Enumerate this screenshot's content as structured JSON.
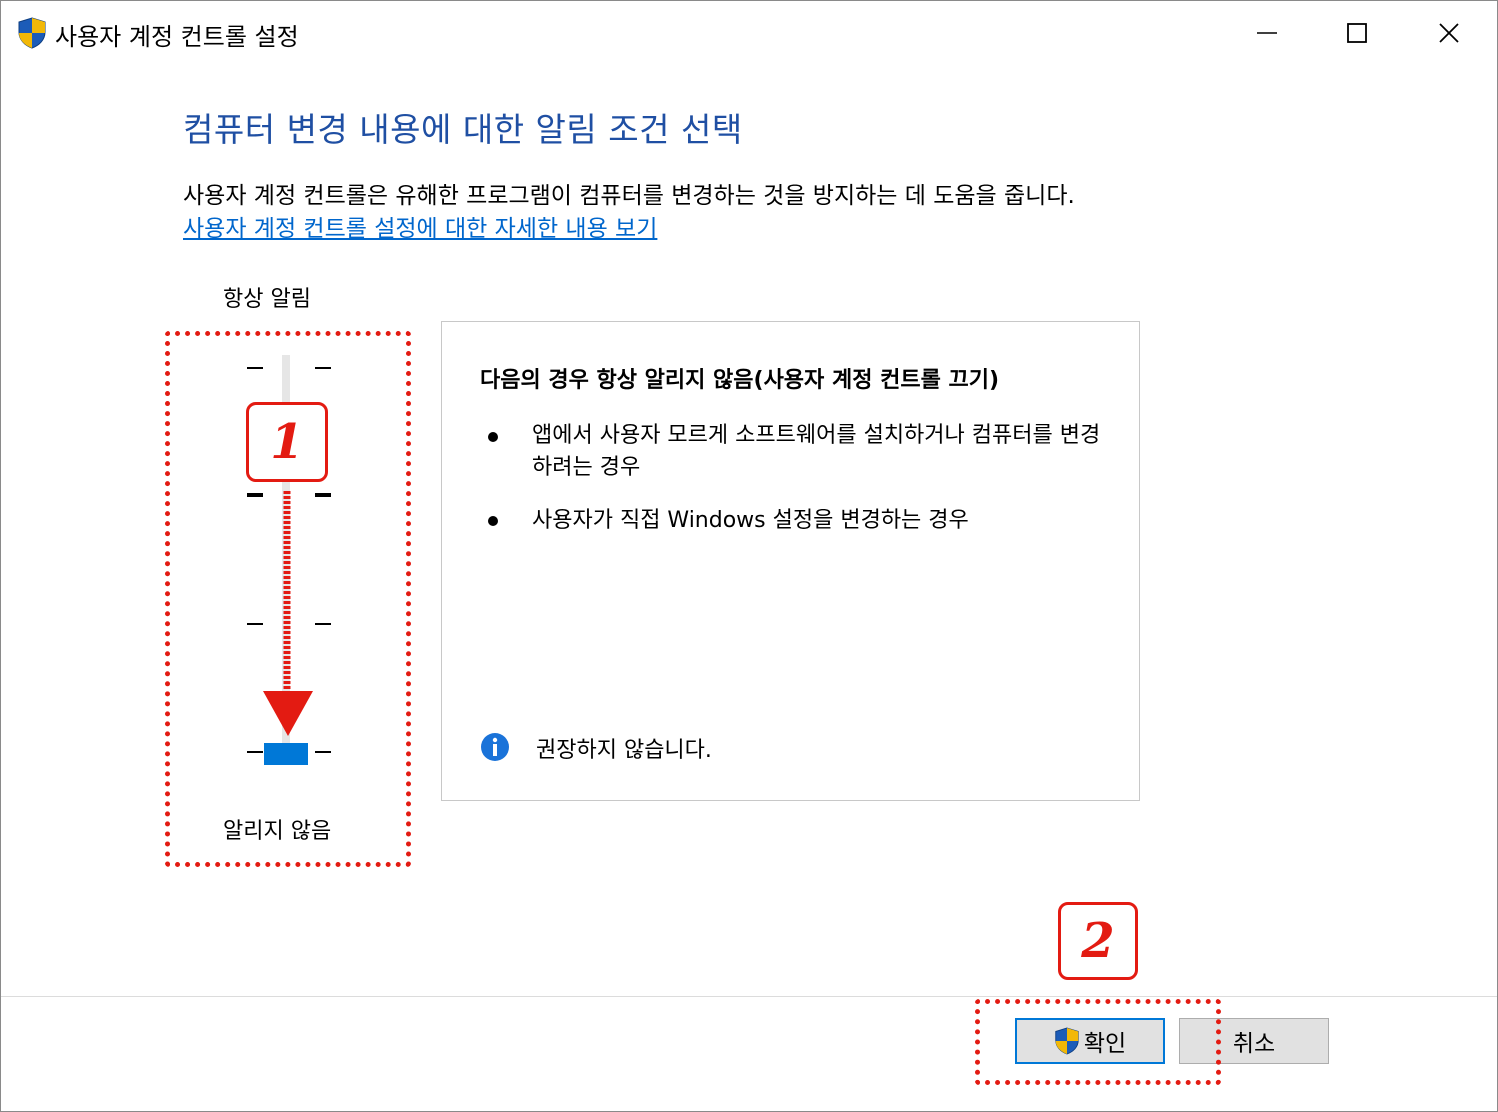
{
  "window": {
    "title": "사용자 계정 컨트롤 설정"
  },
  "main": {
    "heading": "컴퓨터 변경 내용에 대한 알림 조건 선택",
    "description": "사용자 계정 컨트롤은 유해한 프로그램이 컴퓨터를 변경하는 것을 방지하는 데 도움을 줍니다.",
    "help_link": "사용자 계정 컨트롤 설정에 대한 자세한 내용 보기"
  },
  "slider": {
    "top_label": "항상 알림",
    "bottom_label": "알리지 않음",
    "level_count": 4,
    "selected_level": 1
  },
  "panel": {
    "title": "다음의 경우 항상 알리지 않음(사용자 계정 컨트롤 끄기)",
    "bullets": [
      "앱에서 사용자 모르게 소프트웨어를 설치하거나 컴퓨터를 변경하려는 경우",
      "사용자가 직접 Windows 설정을 변경하는 경우"
    ],
    "info_text": "권장하지 않습니다."
  },
  "footer": {
    "ok_label": "확인",
    "cancel_label": "취소"
  },
  "annotations": {
    "badge_1": "1",
    "badge_2": "2"
  },
  "colors": {
    "heading": "#1f4fa3",
    "link": "#0066cc",
    "accent": "#0078d7",
    "annotation": "#e31b12"
  },
  "icons": {
    "app": "uac-shield-icon",
    "ok": "uac-shield-icon",
    "info": "info-icon"
  }
}
